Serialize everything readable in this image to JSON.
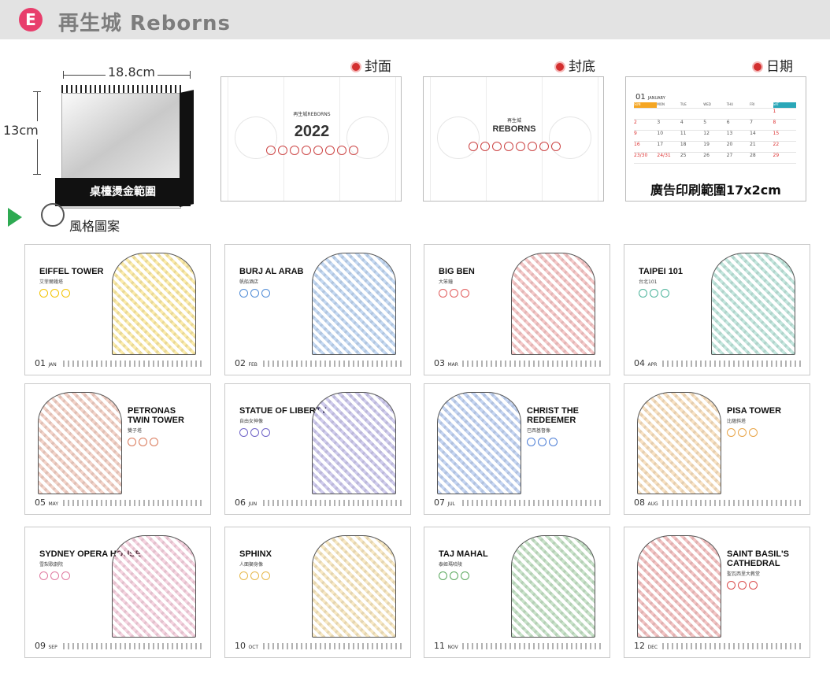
{
  "header": {
    "badge": "E",
    "brand": "再生城 Reborns"
  },
  "product": {
    "width_label": "18.8cm",
    "height_label": "13cm",
    "stand_label": "桌檯燙金範圍"
  },
  "views": [
    {
      "label": "封面",
      "title_small": "再生城REBORNS",
      "title_big": "2022"
    },
    {
      "label": "封底",
      "title_small": "再生城",
      "title_big": "REBORNS"
    },
    {
      "label": "日期",
      "caption": "廣告印刷範圍17x2cm"
    }
  ],
  "calendar_preview": {
    "month": "01",
    "month_name": "JANUARY",
    "weekdays": [
      "SUN",
      "MON",
      "TUE",
      "WED",
      "THU",
      "FRI",
      "SAT"
    ],
    "rows": [
      [
        "",
        "",
        "",
        "",
        "",
        "",
        "1"
      ],
      [
        "2",
        "3",
        "4",
        "5",
        "6",
        "7",
        "8"
      ],
      [
        "9",
        "10",
        "11",
        "12",
        "13",
        "14",
        "15"
      ],
      [
        "16",
        "17",
        "18",
        "19",
        "20",
        "21",
        "22"
      ],
      [
        "23/30",
        "24/31",
        "25",
        "26",
        "27",
        "28",
        "29"
      ]
    ]
  },
  "style_section": {
    "label": "風格圖案"
  },
  "months": [
    {
      "num": "01",
      "abbr": "JAN",
      "title": "EIFFEL TOWER",
      "sub": "艾菲爾鐵塔",
      "accent": "#f2c200"
    },
    {
      "num": "02",
      "abbr": "FEB",
      "title": "BURJ AL ARAB",
      "sub": "帆船酒店",
      "accent": "#4f8bd6"
    },
    {
      "num": "03",
      "abbr": "MAR",
      "title": "BIG BEN",
      "sub": "大笨鐘",
      "accent": "#e05a5a"
    },
    {
      "num": "04",
      "abbr": "APR",
      "title": "TAIPEI 101",
      "sub": "台北101",
      "accent": "#4bb39a"
    },
    {
      "num": "05",
      "abbr": "MAY",
      "title": "PETRONAS\nTWIN TOWER",
      "sub": "雙子塔",
      "accent": "#d9795a"
    },
    {
      "num": "06",
      "abbr": "JUN",
      "title": "STATUE OF LIBERTY",
      "sub": "自由女神像",
      "accent": "#6f63c7"
    },
    {
      "num": "07",
      "abbr": "JUL",
      "title": "CHRIST THE\nREDEEMER",
      "sub": "巴西基督像",
      "accent": "#4f7fd6"
    },
    {
      "num": "08",
      "abbr": "AUG",
      "title": "PISA TOWER",
      "sub": "比薩斜塔",
      "accent": "#e8a447"
    },
    {
      "num": "09",
      "abbr": "SEP",
      "title": "SYDNEY OPERA HOUSE",
      "sub": "雪梨歌劇院",
      "accent": "#e07aa0"
    },
    {
      "num": "10",
      "abbr": "OCT",
      "title": "SPHINX",
      "sub": "人面獅身像",
      "accent": "#e6b84a"
    },
    {
      "num": "11",
      "abbr": "NOV",
      "title": "TAJ MAHAL",
      "sub": "泰姬瑪哈陵",
      "accent": "#59a85c"
    },
    {
      "num": "12",
      "abbr": "DEC",
      "title": "SAINT BASIL'S\nCATHEDRAL",
      "sub": "聖瓦西里大教堂",
      "accent": "#d94c4c"
    }
  ]
}
